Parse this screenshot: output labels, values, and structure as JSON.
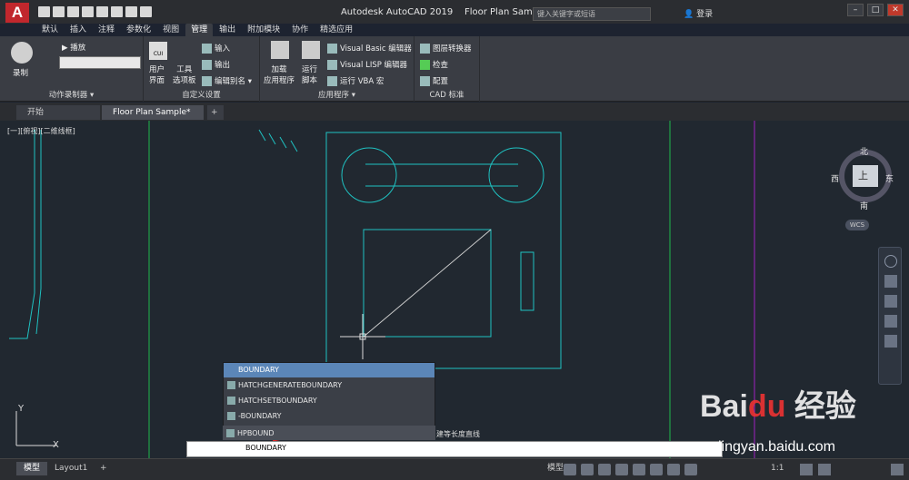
{
  "app": {
    "title": "Autodesk AutoCAD 2019",
    "file": "Floor Plan Sample.dwg",
    "logo": "A"
  },
  "search": {
    "placeholder": "键入关键字或短语"
  },
  "login": "登录",
  "ribbon_tabs": [
    "默认",
    "插入",
    "注释",
    "参数化",
    "视图",
    "管理",
    "输出",
    "附加模块",
    "协作",
    "精选应用"
  ],
  "ribbon": {
    "record": "录制",
    "play": "播放",
    "group_action": "动作录制器 ▾",
    "cui_title": "CUI",
    "user_interface": "用户\n界面",
    "tool_palette": "工具\n选项板",
    "import": "输入",
    "export": "输出",
    "edit_alias": "编辑别名 ▾",
    "group_custom": "自定义设置",
    "load_app": "加载\n应用程序",
    "run_script": "运行\n脚本",
    "vb_editor": "Visual Basic 编辑器",
    "lisp_editor": "Visual LISP 编辑器",
    "run_vba": "运行 VBA 宏",
    "group_apps": "应用程序 ▾",
    "layer_translator": "图层转换器",
    "check": "检查",
    "configure": "配置",
    "group_cad": "CAD 标准"
  },
  "doc_tabs": [
    "开始",
    "Floor Plan Sample*"
  ],
  "viewport_label": "[一][俯视][二维线框]",
  "viewcube": {
    "top": "上",
    "north": "北",
    "south": "南",
    "east": "东",
    "west": "西",
    "wcs": "WCS"
  },
  "autocomplete": {
    "header": "BOUNDARY",
    "items": [
      "HATCHGENERATEBOUNDARY",
      "HATCHSETBOUNDARY",
      "-BOUNDARY",
      "HPBOUND"
    ],
    "tooltip": "建等长度直线"
  },
  "command_line": {
    "value": "BOUNDARY"
  },
  "status_tabs": [
    "模型",
    "Layout1"
  ],
  "status": {
    "model": "模型",
    "scale": "1:1"
  },
  "watermark": {
    "brand": "Bai",
    "brand2": "经验",
    "url": "jingyan.baidu.com"
  }
}
